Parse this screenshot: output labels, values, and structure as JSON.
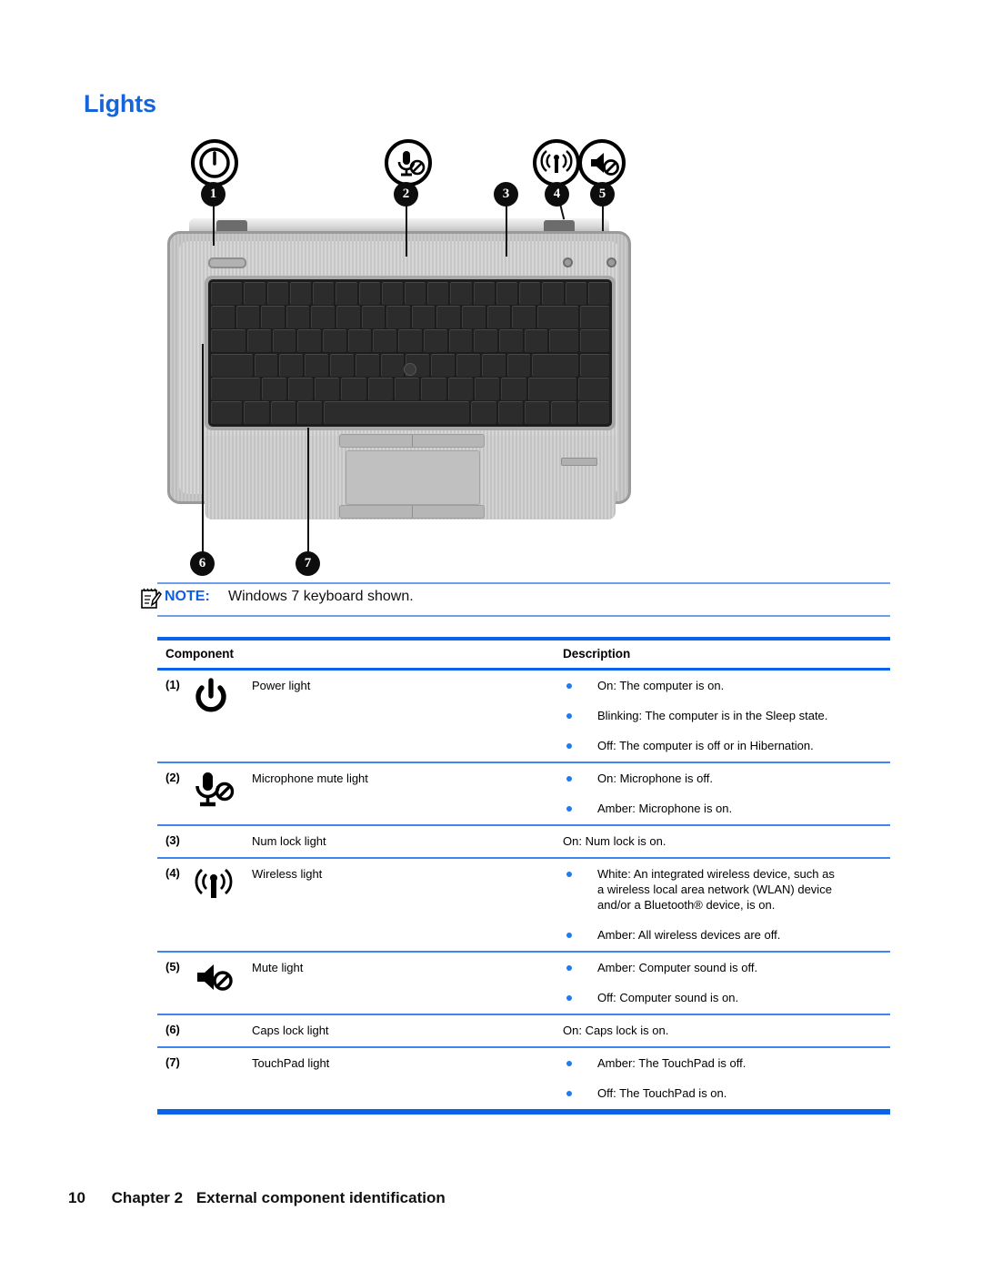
{
  "title": "Lights",
  "figure": {
    "callouts": [
      {
        "n": "1",
        "icon": "power-icon"
      },
      {
        "n": "2",
        "icon": "microphone-mute-icon"
      },
      {
        "n": "3",
        "icon": "none"
      },
      {
        "n": "4",
        "icon": "wireless-icon"
      },
      {
        "n": "5",
        "icon": "mute-icon"
      },
      {
        "n": "6",
        "icon": "none"
      },
      {
        "n": "7",
        "icon": "none"
      }
    ],
    "alt": "HP laptop keyboard and palm rest viewed from above"
  },
  "note": {
    "label": "NOTE:",
    "text": "Windows 7 keyboard shown.",
    "icon": "note-pencil-icon"
  },
  "table": {
    "headers": {
      "component": "Component",
      "description": "Description"
    },
    "rows": [
      {
        "num": "(1)",
        "icon": "power-icon",
        "name": "Power light",
        "bulleted": true,
        "description": [
          "On: The computer is on.",
          "Blinking: The computer is in the Sleep state.",
          "Off: The computer is off or in Hibernation."
        ]
      },
      {
        "num": "(2)",
        "icon": "microphone-mute-icon",
        "name": "Microphone mute light",
        "bulleted": true,
        "description": [
          "On: Microphone is off.",
          "Amber: Microphone is on."
        ]
      },
      {
        "num": "(3)",
        "icon": "none",
        "name": "Num lock light",
        "bulleted": false,
        "description": [
          "On: Num lock is on."
        ]
      },
      {
        "num": "(4)",
        "icon": "wireless-icon",
        "name": "Wireless light",
        "bulleted": true,
        "description": [
          "White: An integrated wireless device, such as a wireless local area network (WLAN) device and/or a Bluetooth® device, is on.",
          "Amber: All wireless devices are off."
        ]
      },
      {
        "num": "(5)",
        "icon": "mute-icon",
        "name": "Mute light",
        "bulleted": true,
        "description": [
          "Amber: Computer sound is off.",
          "Off: Computer sound is on."
        ]
      },
      {
        "num": "(6)",
        "icon": "none",
        "name": "Caps lock light",
        "bulleted": false,
        "description": [
          "On: Caps lock is on."
        ]
      },
      {
        "num": "(7)",
        "icon": "none",
        "name": "TouchPad light",
        "bulleted": true,
        "description": [
          "Amber: The TouchPad is off.",
          "Off: The TouchPad is on."
        ]
      }
    ]
  },
  "footer": {
    "page": "10",
    "chapter": "Chapter 2",
    "title": "External component identification"
  },
  "colors": {
    "title_blue": "#1464dc",
    "rule_blue": "#0a63e8",
    "rule_light_blue": "#3e86ee",
    "bullet_blue": "#1f7bf0",
    "note_blue": "#0f5fe0"
  }
}
